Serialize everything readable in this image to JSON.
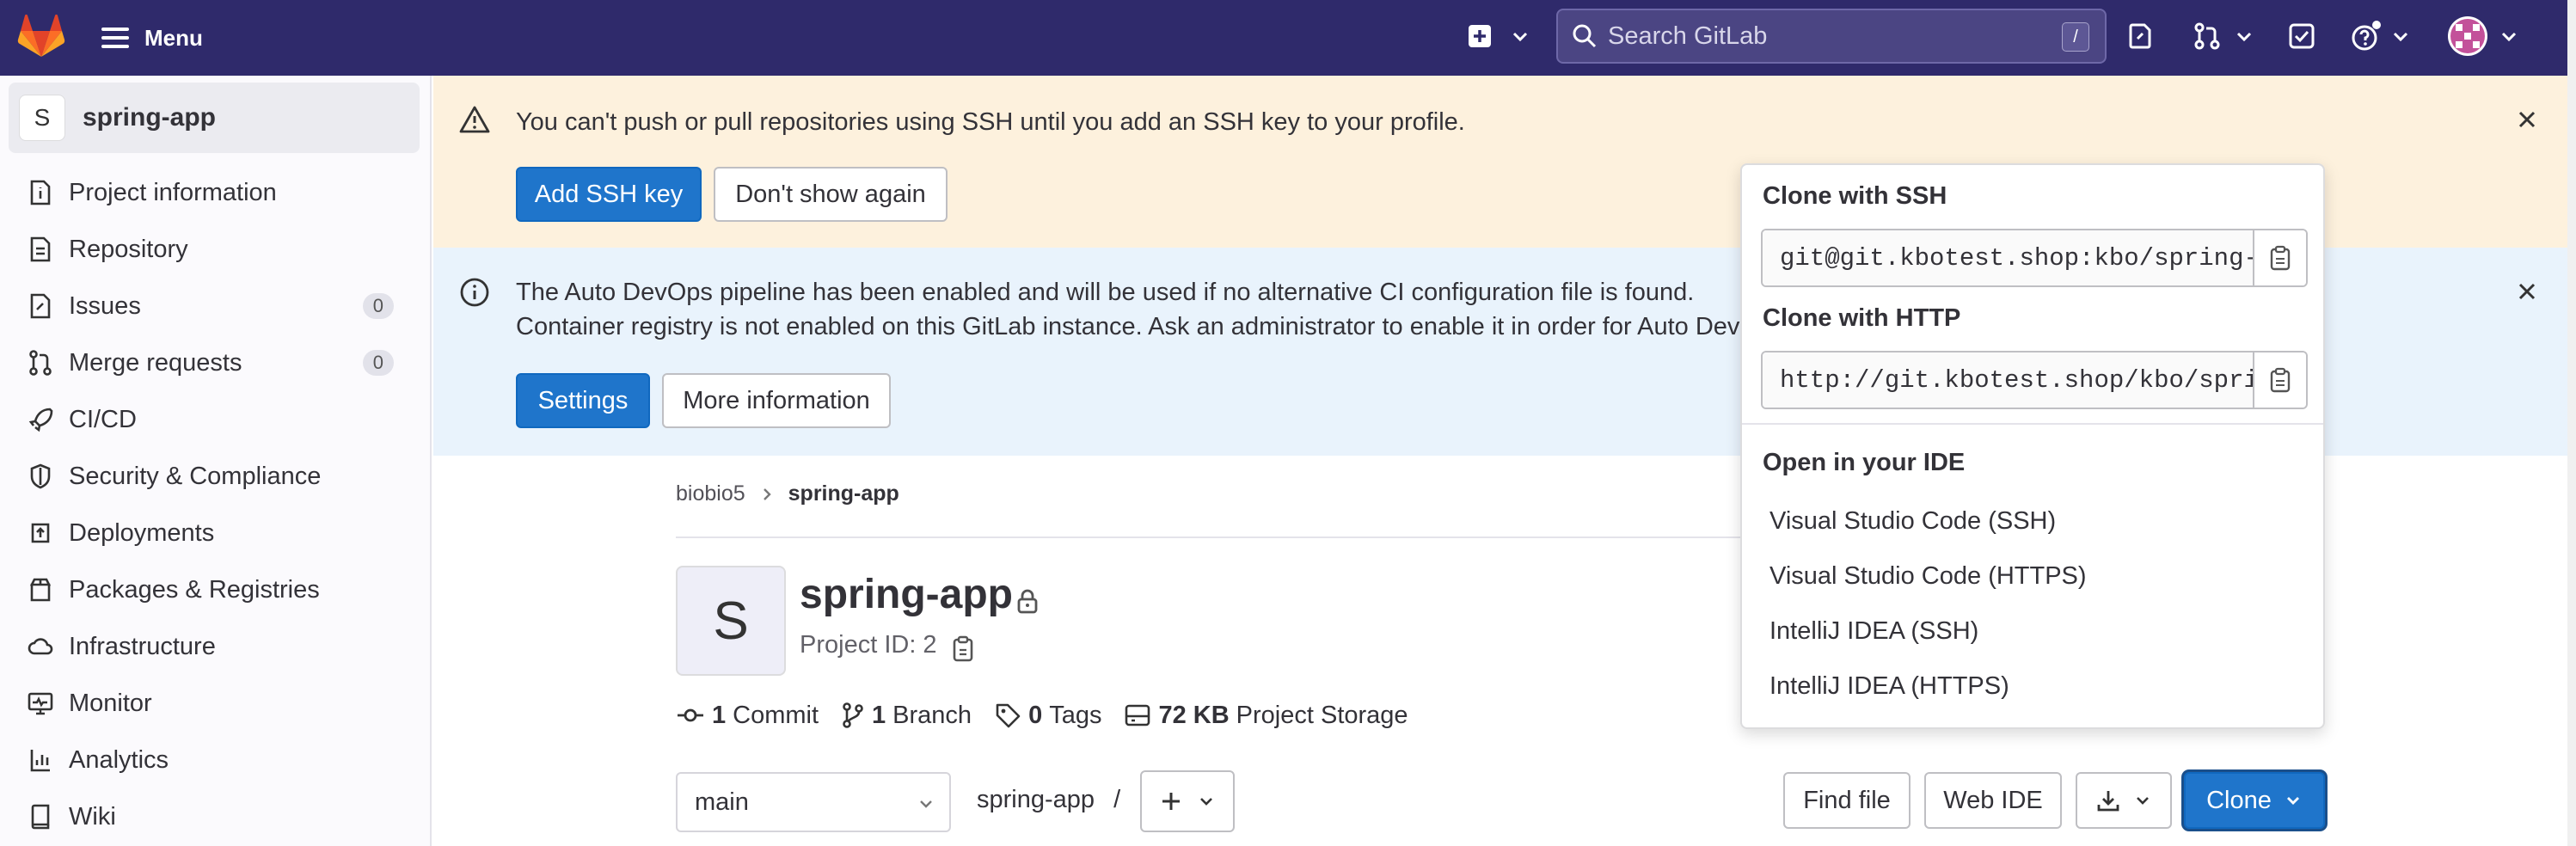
{
  "topbar": {
    "menu_label": "Menu",
    "search_placeholder": "Search GitLab",
    "search_shortcut": "/"
  },
  "sidebar": {
    "project_avatar": "S",
    "project_name": "spring-app",
    "items": [
      {
        "label": "Project information",
        "icon": "info-doc-icon"
      },
      {
        "label": "Repository",
        "icon": "document-icon"
      },
      {
        "label": "Issues",
        "icon": "issues-icon",
        "count": "0"
      },
      {
        "label": "Merge requests",
        "icon": "merge-request-icon",
        "count": "0"
      },
      {
        "label": "CI/CD",
        "icon": "rocket-icon"
      },
      {
        "label": "Security & Compliance",
        "icon": "shield-icon"
      },
      {
        "label": "Deployments",
        "icon": "deployments-icon"
      },
      {
        "label": "Packages & Registries",
        "icon": "package-icon"
      },
      {
        "label": "Infrastructure",
        "icon": "cloud-icon"
      },
      {
        "label": "Monitor",
        "icon": "monitor-icon"
      },
      {
        "label": "Analytics",
        "icon": "chart-icon"
      },
      {
        "label": "Wiki",
        "icon": "book-icon"
      }
    ]
  },
  "alerts": {
    "ssh": {
      "text": "You can't push or pull repositories using SSH until you add an SSH key to your profile.",
      "primary": "Add SSH key",
      "secondary": "Don't show again"
    },
    "devops": {
      "line1": "The Auto DevOps pipeline has been enabled and will be used if no alternative CI configuration file is found.",
      "line2": "Container registry is not enabled on this GitLab instance. Ask an administrator to enable it in order for Auto Dev",
      "primary": "Settings",
      "secondary": "More information"
    }
  },
  "breadcrumb": {
    "parent": "biobio5",
    "current": "spring-app"
  },
  "project": {
    "avatar": "S",
    "title": "spring-app",
    "id_label": "Project ID: 2"
  },
  "stats": {
    "commits_num": "1",
    "commits_label": "Commit",
    "branches_num": "1",
    "branches_label": "Branch",
    "tags_num": "0",
    "tags_label": "Tags",
    "storage_num": "72 KB",
    "storage_label": "Project Storage"
  },
  "repo_bar": {
    "branch": "main",
    "path": "spring-app",
    "path_sep": "/",
    "find_file": "Find file",
    "web_ide": "Web IDE",
    "clone": "Clone"
  },
  "clone_dropdown": {
    "ssh_label": "Clone with SSH",
    "ssh_url": "git@git.kbotest.shop:kbo/spring-app.git",
    "http_label": "Clone with HTTP",
    "http_url": "http://git.kbotest.shop/kbo/spring-app.git",
    "ide_label": "Open in your IDE",
    "ide_options": [
      "Visual Studio Code (SSH)",
      "Visual Studio Code (HTTPS)",
      "IntelliJ IDEA (SSH)",
      "IntelliJ IDEA (HTTPS)"
    ]
  },
  "colors": {
    "topbar": "#2f2a6b",
    "primary": "#1f75cb",
    "ssh_alert_bg": "#fdf1dd",
    "devops_alert_bg": "#e9f3fc"
  }
}
